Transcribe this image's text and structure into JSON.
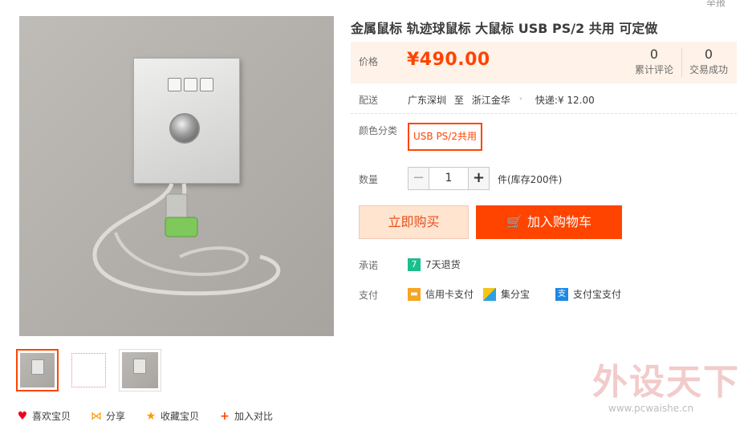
{
  "report_link": "举报",
  "title": "金属鼠标 轨迹球鼠标 大鼠标 USB PS/2 共用 可定做",
  "price": {
    "label": "价格",
    "value": "¥490.00"
  },
  "stats": [
    {
      "count": "0",
      "label": "累计评论"
    },
    {
      "count": "0",
      "label": "交易成功"
    }
  ],
  "shipping": {
    "label": "配送",
    "from": "广东深圳",
    "to_word": "至",
    "to": "浙江金华",
    "method": "快递:¥ 12.00"
  },
  "color": {
    "label": "颜色分类",
    "option": "USB PS/2共用"
  },
  "quantity": {
    "label": "数量",
    "minus": "−",
    "value": "1",
    "plus": "+",
    "stock": "件(库存200件)"
  },
  "buttons": {
    "buy_now": "立即购买",
    "add_cart": "加入购物车"
  },
  "promise": {
    "label": "承诺",
    "icon_text": "7",
    "text": "7天退货"
  },
  "payment": {
    "label": "支付",
    "methods": [
      {
        "name": "信用卡支付",
        "icon": "credit-card-icon",
        "color": "#f5a623"
      },
      {
        "name": "集分宝",
        "icon": "jifenbao-icon",
        "color": "#2ea0e0"
      },
      {
        "name": "支付宝支付",
        "icon": "alipay-icon",
        "color": "#1e88e5"
      }
    ]
  },
  "bottom_actions": [
    {
      "label": "喜欢宝贝",
      "icon": "heart-icon"
    },
    {
      "label": "分享",
      "icon": "share-icon"
    },
    {
      "label": "收藏宝贝",
      "icon": "star-icon"
    },
    {
      "label": "加入对比",
      "icon": "plus-icon"
    }
  ],
  "watermark": {
    "logo": "外设天下",
    "url": "www.pcwaishe.cn"
  },
  "colors": {
    "accent": "#ff4400",
    "price_bg": "#fff2e8",
    "buy_now_bg": "#ffe4d0"
  }
}
